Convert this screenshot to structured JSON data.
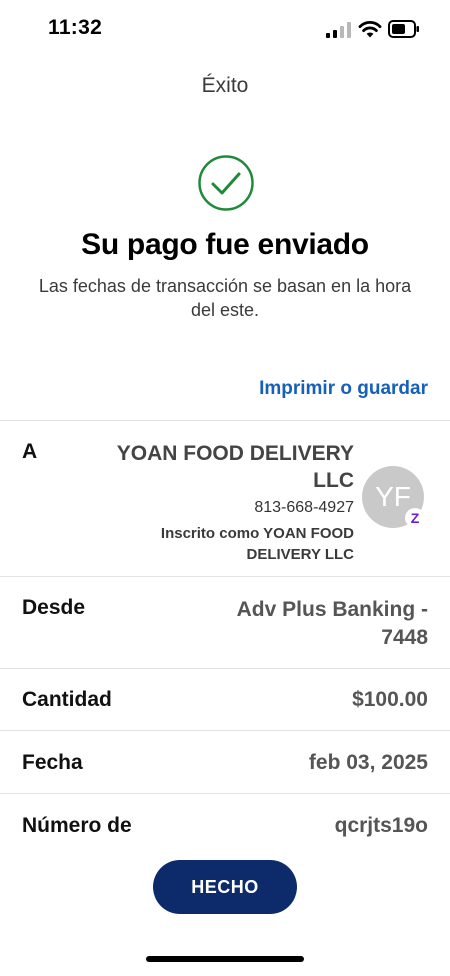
{
  "status_bar": {
    "time": "11:32"
  },
  "header": {
    "title": "Éxito"
  },
  "success": {
    "headline": "Su pago fue enviado",
    "subtext": "Las fechas de transacción se basan en la hora del este."
  },
  "actions": {
    "print_label": "Imprimir o guardar",
    "done_label": "HECHO"
  },
  "recipient": {
    "label": "A",
    "name": "YOAN FOOD DELIVERY LLC",
    "phone": "813-668-4927",
    "enrolled_note": "Inscrito como YOAN FOOD DELIVERY LLC",
    "avatar_initials": "YF",
    "badge_glyph": "Z"
  },
  "details": {
    "from_label": "Desde",
    "from_value": "Adv Plus Banking - 7448",
    "amount_label": "Cantidad",
    "amount_value": "$100.00",
    "date_label": "Fecha",
    "date_value": "feb 03, 2025",
    "number_label": "Número de",
    "number_value": "qcrjts19o"
  },
  "colors": {
    "accent_link": "#1560b8",
    "success_green": "#1f8a3a",
    "button_bg": "#0d2a6b",
    "zelle_purple": "#6d1ed4"
  }
}
